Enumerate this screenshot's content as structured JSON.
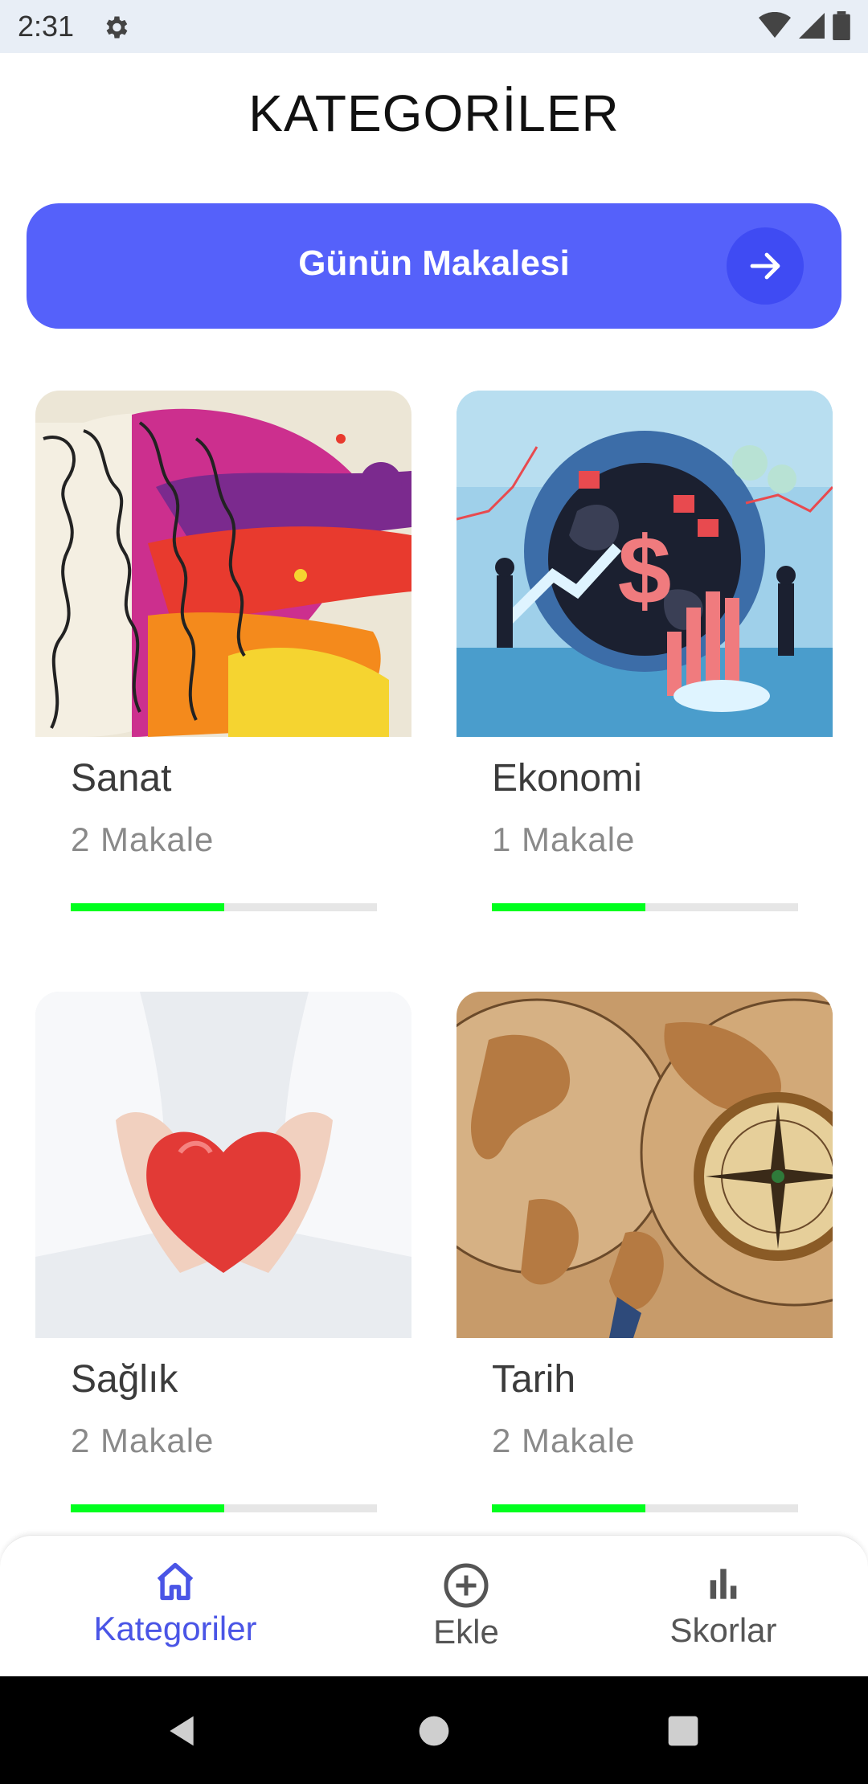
{
  "status_bar": {
    "time": "2:31"
  },
  "header": {
    "title": "KATEGORİLER"
  },
  "banner": {
    "label": "Günün Makalesi"
  },
  "categories": [
    {
      "title": "Sanat",
      "count": "2 Makale",
      "progress": 0.5,
      "image": "colorful-brain-art"
    },
    {
      "title": "Ekonomi",
      "count": "1 Makale",
      "progress": 0.5,
      "image": "economy-globe-illustration"
    },
    {
      "title": "Sağlık",
      "count": "2 Makale",
      "progress": 0.5,
      "image": "hands-holding-heart"
    },
    {
      "title": "Tarih",
      "count": "2 Makale",
      "progress": 0.5,
      "image": "old-map-compass"
    }
  ],
  "bottom_nav": {
    "items": [
      {
        "label": "Kategoriler",
        "icon": "home-icon",
        "active": true
      },
      {
        "label": "Ekle",
        "icon": "add-circle-icon",
        "active": false
      },
      {
        "label": "Skorlar",
        "icon": "bar-chart-icon",
        "active": false
      }
    ]
  },
  "colors": {
    "accent": "#5561FA",
    "progress": "#00FF1E",
    "nav_active": "#4A55E6",
    "nav_inactive": "#555555"
  }
}
